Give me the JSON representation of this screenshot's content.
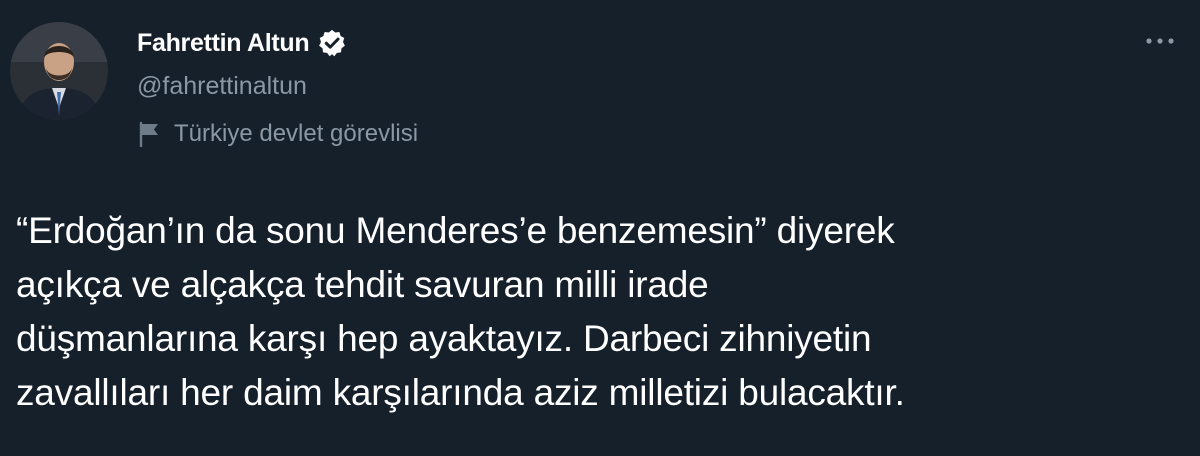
{
  "author": {
    "display_name": "Fahrettin Altun",
    "handle": "@fahrettinaltun",
    "verified": true,
    "verified_icon": "verified-badge-icon",
    "label": "Türkiye devlet görevlisi",
    "label_icon": "flag-icon"
  },
  "menu": {
    "more_icon": "more-horizontal-icon"
  },
  "tweet": {
    "lines": [
      "“Erdoğan’ın da sonu Menderes’e benzemesin” diyerek",
      "açıkça ve alçakça tehdit savuran milli irade",
      "düşmanlarına karşı hep ayaktayız. Darbeci zihniyetin",
      "zavallıları her daim karşılarında aziz milletizi bulacaktır."
    ]
  },
  "colors": {
    "background": "#15202b",
    "primary_text": "#ffffff",
    "secondary_text": "#8b98a5"
  }
}
